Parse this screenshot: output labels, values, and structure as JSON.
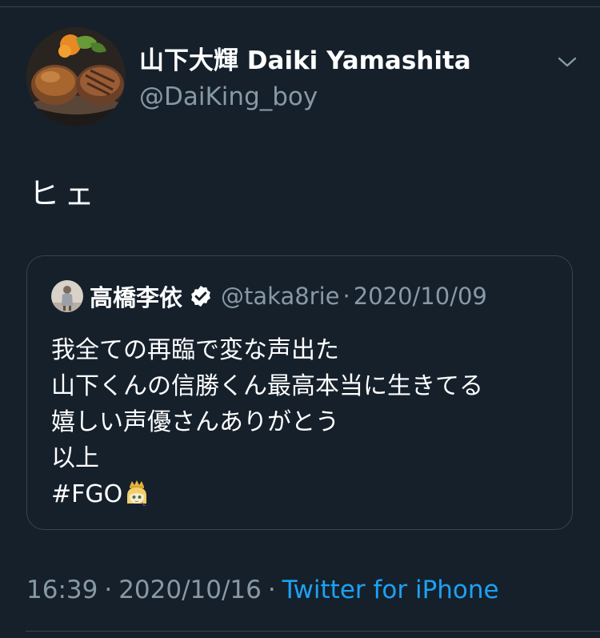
{
  "tweet": {
    "author": {
      "display_name": "山下大輝 Daiki Yamashita",
      "handle": "@DaiKing_boy"
    },
    "text": "ヒェ",
    "time": "16:39",
    "separator": "·",
    "date": "2020/10/16",
    "source": "Twitter for iPhone"
  },
  "quoted_tweet": {
    "author": {
      "display_name": "高橋李依",
      "handle": "@taka8rie",
      "verified": true
    },
    "separator": "·",
    "date": "2020/10/09",
    "lines": [
      "我全ての再臨で変な声出た",
      "山下くんの信勝くん最高本当に生きてる",
      "嬉しい声優さんありがとう",
      "以上",
      "#FGO"
    ],
    "trailing_emoji": "crowned-character-emoji"
  },
  "colors": {
    "background": "#15202b",
    "divider": "#38444d",
    "secondary_text": "#8899a6",
    "link": "#1da1f2",
    "verified_badge": "#ffffff"
  },
  "icons": {
    "menu": "chevron-down-icon",
    "verified": "verified-badge-icon"
  }
}
